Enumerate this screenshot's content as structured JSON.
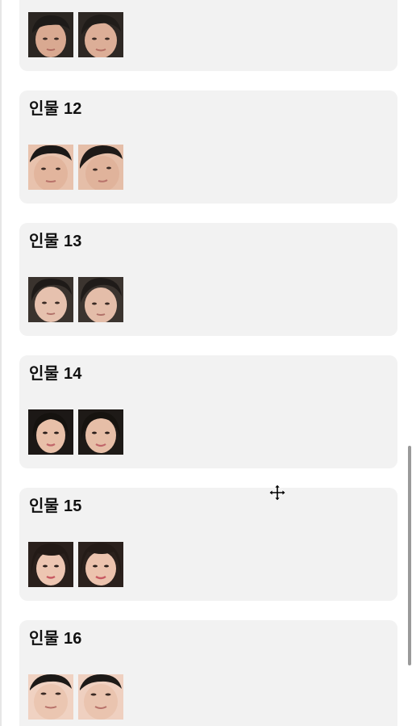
{
  "people": [
    {
      "title": "",
      "face_ids": [
        "face-11-a",
        "face-11-b"
      ]
    },
    {
      "title": "인물 12",
      "face_ids": [
        "face-12-a",
        "face-12-b"
      ]
    },
    {
      "title": "인물 13",
      "face_ids": [
        "face-13-a",
        "face-13-b"
      ]
    },
    {
      "title": "인물 14",
      "face_ids": [
        "face-14-a",
        "face-14-b"
      ]
    },
    {
      "title": "인물 15",
      "face_ids": [
        "face-15-a",
        "face-15-b"
      ]
    },
    {
      "title": "인물 16",
      "face_ids": [
        "face-16-a",
        "face-16-b"
      ]
    }
  ],
  "icons": {
    "cursor": "move-cursor-icon"
  },
  "colors": {
    "card_bg": "#f2f2f2",
    "page_bg": "#ffffff",
    "title_text": "#111111",
    "scroll_thumb": "#9a9a9a"
  },
  "scroll": {
    "position_fraction": 0.62
  }
}
